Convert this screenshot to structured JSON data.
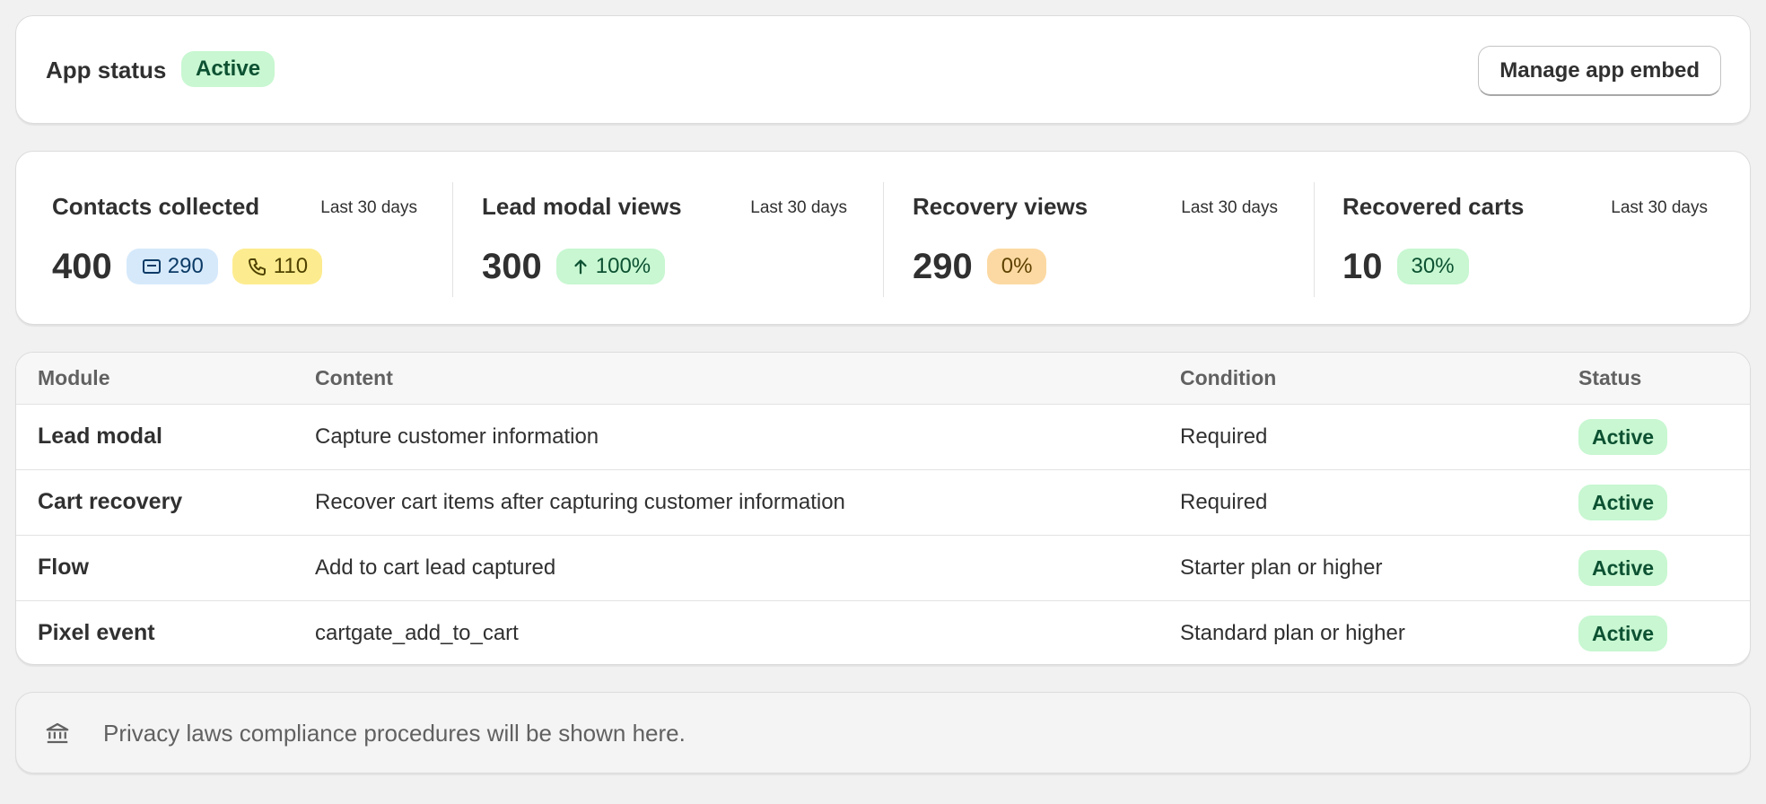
{
  "app_status": {
    "title": "App status",
    "badge": "Active",
    "manage_button": "Manage app embed"
  },
  "metrics": [
    {
      "title": "Contacts collected",
      "period": "Last 30 days",
      "value": "400",
      "badges": [
        {
          "icon": "mail-icon",
          "text": "290",
          "color": "blue"
        },
        {
          "icon": "phone-icon",
          "text": "110",
          "color": "yellow"
        }
      ]
    },
    {
      "title": "Lead modal views",
      "period": "Last 30 days",
      "value": "300",
      "badges": [
        {
          "icon": "arrow-up-icon",
          "text": "100%",
          "color": "green"
        }
      ]
    },
    {
      "title": "Recovery views",
      "period": "Last 30 days",
      "value": "290",
      "badges": [
        {
          "icon": "",
          "text": "0%",
          "color": "orange"
        }
      ]
    },
    {
      "title": "Recovered carts",
      "period": "Last 30 days",
      "value": "10",
      "badges": [
        {
          "icon": "",
          "text": "30%",
          "color": "green"
        }
      ]
    }
  ],
  "table": {
    "headers": [
      "Module",
      "Content",
      "Condition",
      "Status"
    ],
    "rows": [
      {
        "module": "Lead modal",
        "content": "Capture customer information",
        "condition": "Required",
        "status": "Active"
      },
      {
        "module": "Cart recovery",
        "content": "Recover cart items after capturing customer information",
        "condition": "Required",
        "status": "Active"
      },
      {
        "module": "Flow",
        "content": "Add to cart lead captured",
        "condition": "Starter plan or higher",
        "status": "Active"
      },
      {
        "module": "Pixel event",
        "content": "cartgate_add_to_cart",
        "condition": "Standard plan or higher",
        "status": "Active"
      }
    ]
  },
  "privacy": {
    "icon": "bank-icon",
    "text": "Privacy laws compliance procedures will be shown here."
  },
  "colors": {
    "background": "#f1f1f1",
    "active_badge_bg": "#c8f7d1",
    "blue_badge_bg": "#d6e9fb",
    "yellow_badge_bg": "#fdec8f",
    "orange_badge_bg": "#fcd9a3"
  }
}
